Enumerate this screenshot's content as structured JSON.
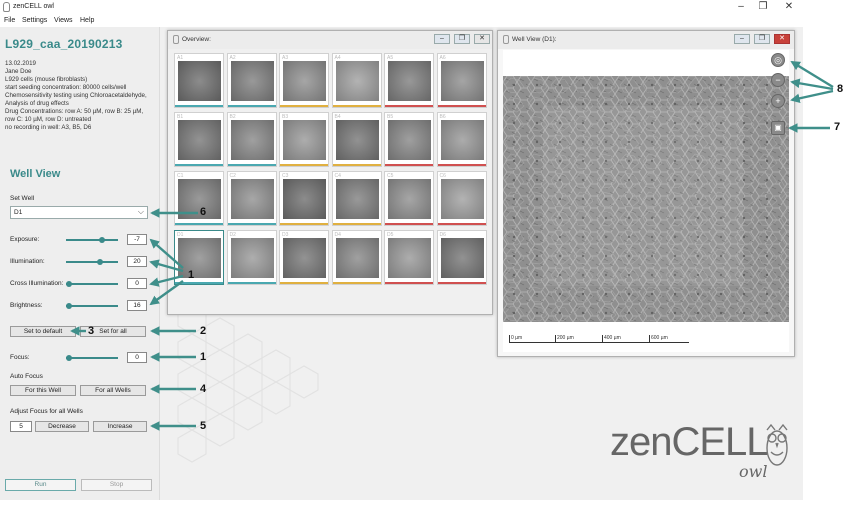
{
  "window": {
    "title": "zenCELL owl",
    "controls": [
      "–",
      "❐",
      "✕"
    ]
  },
  "menu": [
    "File",
    "Settings",
    "Views",
    "Help"
  ],
  "experiment": {
    "name": "L929_caa_20190213",
    "info_lines": [
      "13.02.2019",
      "Jane Doe",
      "L929 cells (mouse fibroblasts)",
      "start seeding concentration: 80000 cells/well",
      "Chemosensitivity testing using Chloroacetaldehyde,",
      "Analysis of drug effects",
      "Drug Concentrations: row A: 50 µM, row B: 25 µM,",
      "row C: 10 µM, row D: untreated",
      "no recording in well: A3, B5, D6"
    ]
  },
  "well_view_panel": {
    "title": "Well View",
    "set_well_label": "Set Well",
    "set_well_value": "D1",
    "sliders": [
      {
        "label": "Exposure:",
        "value": "-7",
        "level": 0.7
      },
      {
        "label": "Illumination:",
        "value": "20",
        "level": 0.65
      },
      {
        "label": "Cross Illumination:",
        "value": "0",
        "level": 0.05
      },
      {
        "label": "Brightness:",
        "value": "16",
        "level": 0.05
      }
    ],
    "set_default": "Set to default",
    "set_all": "Set for all",
    "focus_label": "Focus:",
    "focus_value": "0",
    "focus_level": 0.05,
    "auto_focus_label": "Auto Focus",
    "for_this_well": "For this Well",
    "for_all_wells": "For all Wells",
    "adjust_focus_label": "Adjust Focus for all Wells",
    "adjust_value": "5",
    "decrease": "Decrease",
    "increase": "Increase",
    "run": "Run",
    "stop": "Stop"
  },
  "overview": {
    "title": "Overview:",
    "rows": [
      "A",
      "B",
      "C",
      "D"
    ],
    "cols": [
      1,
      2,
      3,
      4,
      5,
      6
    ],
    "stripe_colors": [
      "#4aa8b0",
      "#4aa8b0",
      "#e0b040",
      "#e0b040",
      "#d05050",
      "#d05050"
    ],
    "selected_well": "D1"
  },
  "well_view_window": {
    "title": "Well View (D1):",
    "scale_labels": [
      "0 µm",
      "200 µm",
      "400 µm",
      "600 µm"
    ],
    "side_icons": [
      "zoom-fit-icon",
      "zoom-out-icon",
      "zoom-in-icon",
      "save-icon"
    ]
  },
  "callouts": [
    "1",
    "2",
    "3",
    "1",
    "4",
    "5",
    "6",
    "7",
    "8"
  ],
  "logo": {
    "main": "zenCELL",
    "sub": "owl"
  },
  "colors": {
    "accent": "#3a8a8a",
    "arrow": "#3f8f8a"
  }
}
